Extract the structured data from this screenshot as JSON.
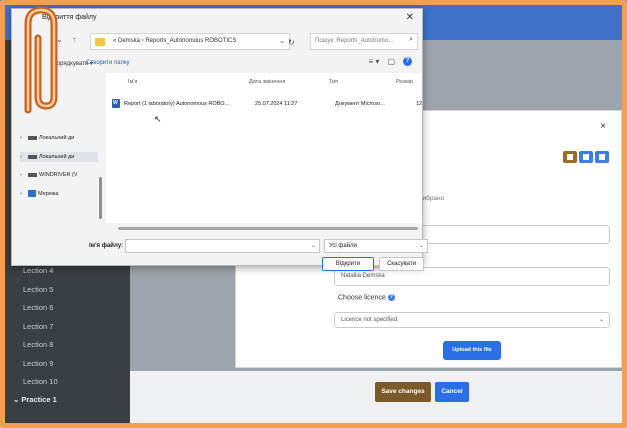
{
  "dialog": {
    "title": "Відкриття файлу",
    "address_path": "« Demska  ›  Reports_Autonomous ROBOTICS",
    "search_placeholder": "Пошук: Reports_Autonomo...",
    "toolbar": {
      "organize": "Упорядкувати ▾",
      "new_folder": "Створити папку"
    },
    "nav_items": [
      {
        "label": "Локальний ди",
        "kind": "drive"
      },
      {
        "label": "Локальний ди",
        "kind": "drive",
        "selected": true
      },
      {
        "label": "WINDRIVER (V",
        "kind": "drive"
      },
      {
        "label": "Мережа",
        "kind": "network"
      }
    ],
    "columns": [
      "Ім'я",
      "Дата змінення",
      "Тип",
      "Розмір"
    ],
    "files": [
      {
        "name": "Report (1 laboratory) Autonomous ROBO...",
        "modified": "25.07.2024 11:27",
        "type": "Документ Microso...",
        "size": "12"
      }
    ],
    "file_name_label": "Ім'я файлу:",
    "file_name_value": "",
    "file_type_value": "Усі файли",
    "open_button": "Відкрити",
    "cancel_button": "Скасувати"
  },
  "file_picker": {
    "no_file_text": "не вибрано",
    "author_value": "Nataliia Demska",
    "licence_label": "Choose licence",
    "licence_value": "Licence not specified",
    "upload_button": "Upload this file"
  },
  "sidebar": {
    "items": [
      "Lection 4",
      "Lection 5",
      "Lection 6",
      "Lection 7",
      "Lection 8",
      "Lection 9",
      "Lection 10"
    ],
    "section": "Practice 1"
  },
  "form_buttons": {
    "save": "Save changes",
    "cancel": "Cancel"
  },
  "colors": {
    "frame": "#f0a050",
    "accent_blue": "#2a6ee8",
    "save_brown": "#7a5a28",
    "sidebar": "#3a3f45"
  }
}
